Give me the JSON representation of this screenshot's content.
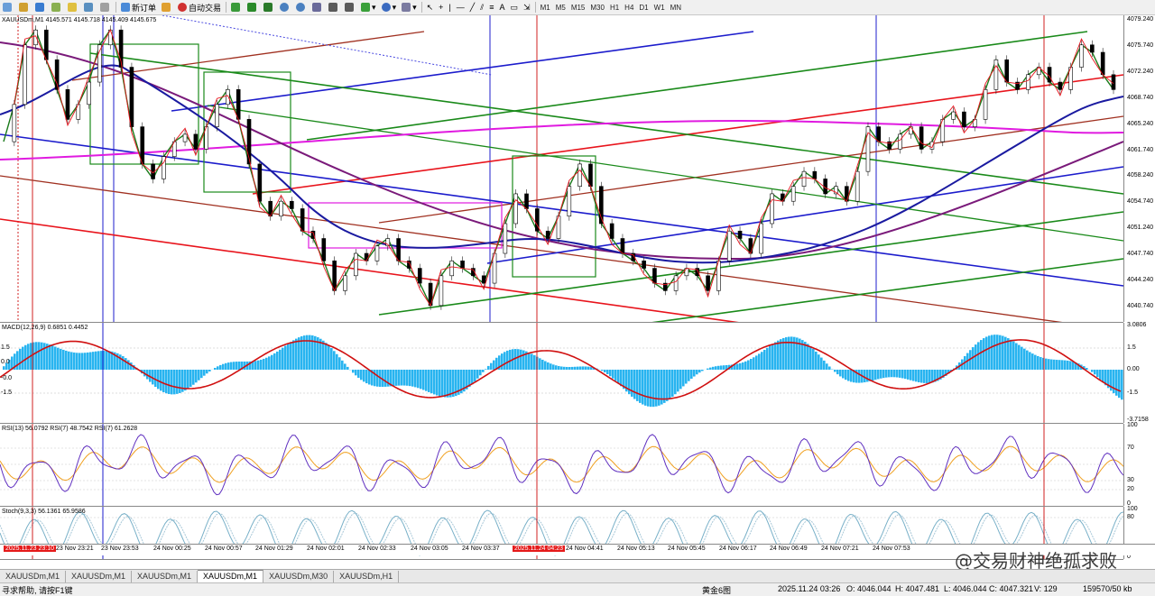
{
  "toolbar": {
    "new_order": "新订单",
    "auto_trade": "自动交易",
    "timeframes": [
      "M1",
      "M5",
      "M15",
      "M30",
      "H1",
      "H4",
      "D1",
      "W1",
      "MN"
    ]
  },
  "chart": {
    "title": "XAUUSDm,M1  4145.571 4145.718 4145.409 4145.675",
    "price_labels": [
      "4079.240",
      "4075.740",
      "4072.240",
      "4068.740",
      "4065.240",
      "4061.740",
      "4058.240",
      "4054.740",
      "4051.240",
      "4047.740",
      "4044.240",
      "4040.740"
    ],
    "macd_label": "MACD(12,26,9) 0.6851 0.4452",
    "macd_scale": [
      "3.0806",
      "1.5",
      "0.00",
      "-1.5",
      "-3.7158"
    ],
    "macd_levels": [
      "1.5",
      "0.0",
      "-0.0",
      "-1.5"
    ],
    "rsi_label": "RSI(13) 56.0792  RSI(7) 48.7542  RSI(7) 61.2628",
    "rsi_scale": [
      "100",
      "70",
      "30",
      "20",
      "0"
    ],
    "stoch_label": "Stoch(9,3,3) 56.1361 65.9586",
    "stoch_scale": [
      "100",
      "80",
      "20",
      "0"
    ],
    "time_labels": [
      "2025.11.23 23:10",
      "23 Nov 23:21",
      "23 Nov 23:53",
      "24 Nov 00:25",
      "24 Nov 00:57",
      "24 Nov 01:29",
      "24 Nov 02:01",
      "24 Nov 02:33",
      "24 Nov 03:05",
      "24 Nov 03:37",
      "2025.11.24 04:23",
      "24 Nov 04:41",
      "24 Nov 05:13",
      "24 Nov 05:45",
      "24 Nov 06:17",
      "24 Nov 06:49",
      "24 Nov 07:21",
      "24 Nov 07:53"
    ],
    "chart_data": {
      "type": "line",
      "symbol": "XAUUSDm",
      "timeframe": "M1",
      "ohlc_header": {
        "open": 4145.571,
        "high": 4145.718,
        "low": 4145.409,
        "close": 4145.675
      },
      "price_range": [
        4040.74,
        4079.24
      ],
      "price_series": [
        4063,
        4068,
        4076,
        4078,
        4074,
        4070,
        4066,
        4068,
        4071,
        4076,
        4078,
        4073,
        4065,
        4060,
        4058,
        4061,
        4063,
        4064,
        4062,
        4065,
        4068,
        4070,
        4066,
        4060,
        4055,
        4053,
        4055,
        4054,
        4051,
        4050,
        4047,
        4043,
        4045,
        4048,
        4047,
        4049,
        4050,
        4047,
        4046,
        4044,
        4041,
        4045,
        4047,
        4046,
        4045,
        4044,
        4048,
        4052,
        4056,
        4054,
        4051,
        4050,
        4053,
        4057,
        4060,
        4057,
        4052,
        4050,
        4048,
        4047,
        4046,
        4044,
        4043,
        4045,
        4046,
        4045,
        4043,
        4047,
        4051,
        4050,
        4048,
        4052,
        4056,
        4055,
        4057,
        4059,
        4058,
        4056,
        4057,
        4055,
        4059,
        4065,
        4063,
        4062,
        4064,
        4065,
        4062,
        4063,
        4066,
        4067,
        4065,
        4066,
        4070,
        4074,
        4071,
        4070,
        4072,
        4073,
        4071,
        4070,
        4073,
        4076,
        4075,
        4072,
        4070
      ]
    }
  },
  "tabs": [
    "XAUUSDm,M1",
    "XAUUSDm,M1",
    "XAUUSDm,M1",
    "XAUUSDm,M1",
    "XAUUSDm,M30",
    "XAUUSDm,H1"
  ],
  "status": {
    "help": "寻求帮助, 请按F1键",
    "profile": "黄金6图",
    "datetime": "2025.11.24 03:26",
    "open": "O: 4046.044",
    "high": "H: 4047.481",
    "low": "L: 4046.044",
    "close": "C: 4047.321",
    "volume": "V: 129",
    "traffic": "159570/50 kb"
  },
  "watermark": "@交易财神绝孤求败",
  "colors": {
    "bull": "#00a000",
    "red_line": "#e8141c",
    "blue_line": "#1c1ccc",
    "green_line": "#1a8a1a",
    "brown_line": "#a03020",
    "magenta_line": "#e01ae0",
    "purple_line": "#7a1a7a",
    "macd_hist": "#28b4f0",
    "rsi_a": "#6030c0",
    "rsi_b": "#f0a020",
    "stoch": "#78b0c8"
  }
}
